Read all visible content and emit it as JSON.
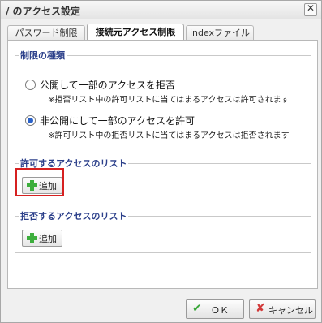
{
  "dialog": {
    "title": "/ のアクセス設定",
    "close_glyph": "✕"
  },
  "tabs": [
    {
      "label": "パスワード制限",
      "active": false
    },
    {
      "label": "接続元アクセス制限",
      "active": true
    },
    {
      "label": "indexファイル",
      "active": false
    }
  ],
  "restriction_type": {
    "legend": "制限の種類",
    "options": [
      {
        "label": "公開して一部のアクセスを拒否",
        "note": "※拒否リスト中の許可リストに当てはまるアクセスは許可されます",
        "checked": false
      },
      {
        "label": "非公開にして一部のアクセスを許可",
        "note": "※許可リスト中の拒否リストに当てはまるアクセスは拒否されます",
        "checked": true
      }
    ]
  },
  "allow_list": {
    "legend": "許可するアクセスのリスト",
    "add_label": "追加"
  },
  "deny_list": {
    "legend": "拒否するアクセスのリスト",
    "add_label": "追加"
  },
  "footer": {
    "ok_label": "ＯＫ",
    "cancel_label": "キャンセル"
  },
  "colors": {
    "highlight": "#d62020",
    "legend_text": "#2b3f8a",
    "plus_icon": "#3cae3c"
  }
}
